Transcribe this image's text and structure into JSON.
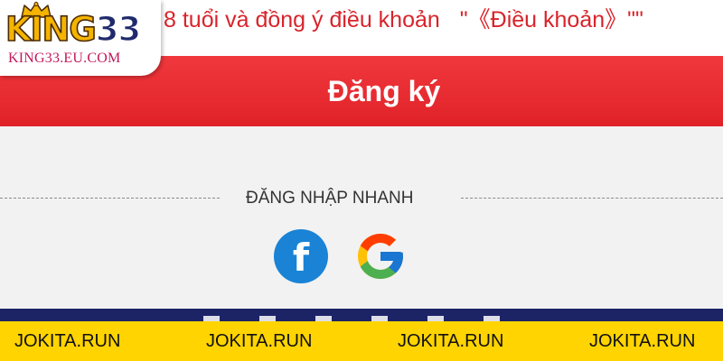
{
  "header": {
    "terms_text": "8 tuổi và đồng ý điều khoản",
    "terms_link": "\"《Điều khoản》\"\""
  },
  "logo": {
    "wordmark_letters": "KING",
    "wordmark_number": "33",
    "url": "KING33.EU.COM",
    "icon": "crown-icon"
  },
  "register": {
    "label": "Đăng ký"
  },
  "quick_login": {
    "label": "ĐĂNG NHẬP NHANH",
    "providers": [
      {
        "name": "facebook",
        "icon": "facebook-icon",
        "color": "#1a83d6"
      },
      {
        "name": "google",
        "icon": "google-icon"
      }
    ]
  },
  "ticker": {
    "items": [
      "JOKITA.RUN",
      "JOKITA.RUN",
      "JOKITA.RUN",
      "JOKITA.RUN"
    ]
  },
  "colors": {
    "accent_red": "#e02228",
    "navy": "#1c2466",
    "ticker_yellow": "#ffd400",
    "logo_gold": "#f4b400"
  }
}
